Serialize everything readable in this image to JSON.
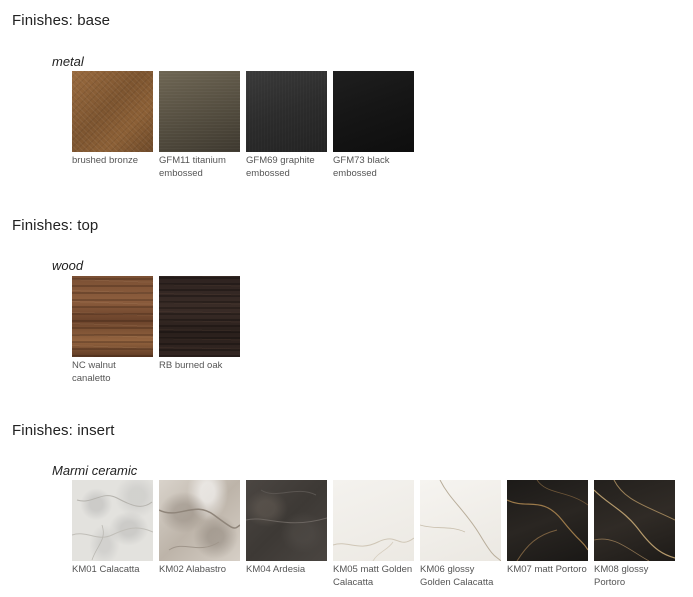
{
  "sections": [
    {
      "title": "Finishes: base",
      "category": "metal",
      "swatches": [
        {
          "label": "brushed bronze"
        },
        {
          "label": "GFM11 titanium embossed"
        },
        {
          "label": "GFM69 graphite embossed"
        },
        {
          "label": "GFM73 black embossed"
        }
      ]
    },
    {
      "title": "Finishes: top",
      "category": "wood",
      "swatches": [
        {
          "label": "NC walnut canaletto"
        },
        {
          "label": "RB burned oak"
        }
      ]
    },
    {
      "title": "Finishes: insert",
      "category": "Marmi ceramic",
      "swatches": [
        {
          "label": "KM01 Calacatta"
        },
        {
          "label": "KM02 Alabastro"
        },
        {
          "label": "KM04 Ardesia"
        },
        {
          "label": "KM05 matt Golden Calacatta"
        },
        {
          "label": "KM06 glossy Golden Calacatta"
        },
        {
          "label": "KM07 matt Portoro"
        },
        {
          "label": "KM08 glossy Portoro"
        }
      ]
    }
  ]
}
